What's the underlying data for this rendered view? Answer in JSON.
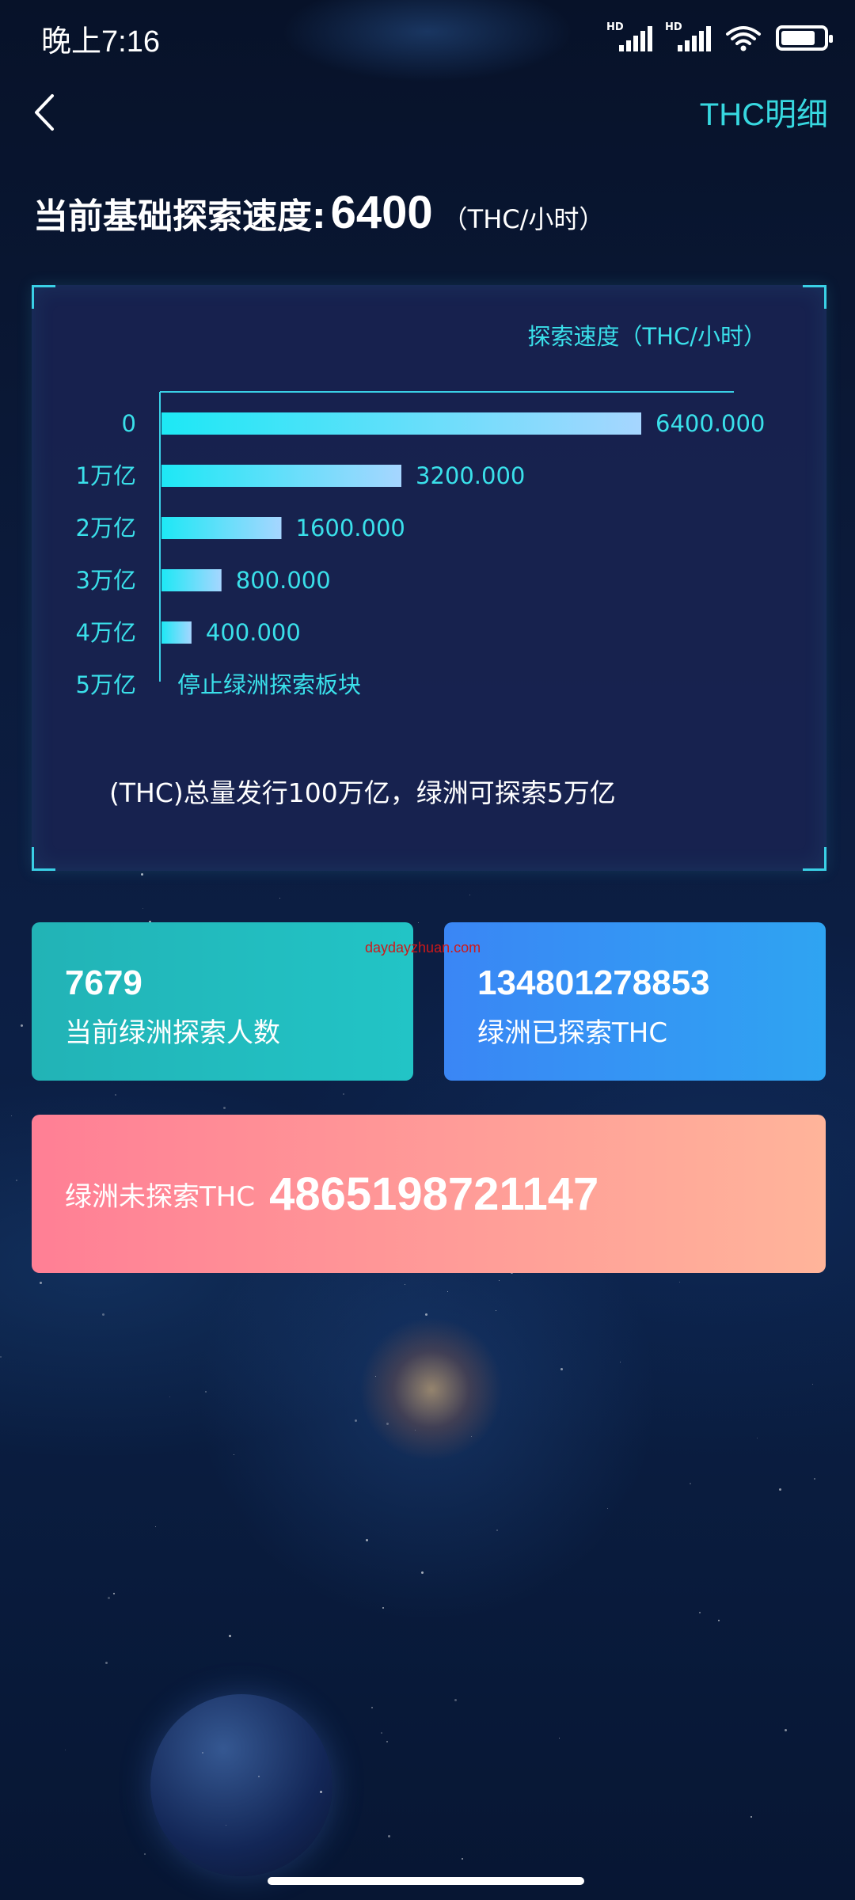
{
  "status_bar": {
    "time": "晚上7:16",
    "hd1": "HD",
    "hd2": "HD",
    "battery_level": 0.8
  },
  "nav": {
    "detail_label": "THC明细"
  },
  "speed": {
    "label": "当前基础探索速度:",
    "value": "6400",
    "unit": "（THC/小时）"
  },
  "chart_data": {
    "type": "bar",
    "orientation": "horizontal",
    "legend": "探索速度（THC/小时）",
    "categories": [
      "0",
      "1万亿",
      "2万亿",
      "3万亿",
      "4万亿",
      "5万亿"
    ],
    "values": [
      6400,
      3200,
      1600,
      800,
      400,
      0
    ],
    "value_labels": [
      "6400.000",
      "3200.000",
      "1600.000",
      "800.000",
      "400.000",
      "停止绿洲探索板块"
    ],
    "xlim": [
      0,
      6400
    ]
  },
  "chart_note": "(THC)总量发行100万亿，绿洲可探索5万亿",
  "stats": {
    "explorers_value": "7679",
    "explorers_label": "当前绿洲探索人数",
    "explored_value": "134801278853",
    "explored_label": "绿洲已探索THC",
    "unexplored_label": "绿洲未探索THC",
    "unexplored_value": "4865198721147"
  },
  "watermark": "daydayzhuan.com",
  "colors": {
    "accent": "#37d8e0",
    "teal_card": "#22b3b6",
    "blue_card": "#3a86f5",
    "pink_card": "#ff7f95"
  }
}
